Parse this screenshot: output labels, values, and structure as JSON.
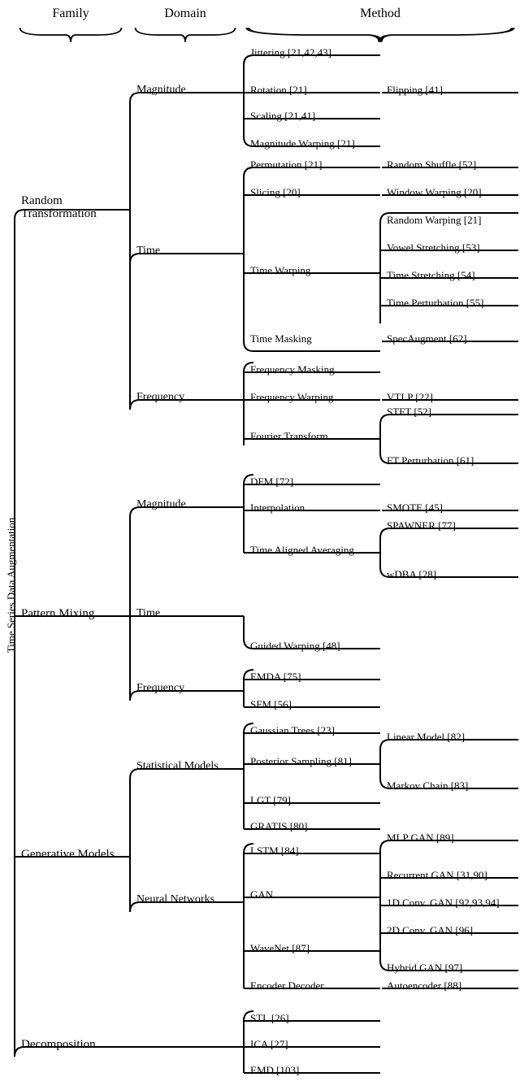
{
  "headers": {
    "family": "Family",
    "domain": "Domain",
    "method": "Method"
  },
  "root": "Time Series Data Augmentation",
  "fam_rt": "Random\nTransformation",
  "fam_pm": "Pattern Mixing",
  "fam_gm": "Generative Models",
  "fam_dc": "Decomposition",
  "d_mag": "Magnitude",
  "d_time": "Time",
  "d_freq": "Frequency",
  "d_stat": "Statistical Models",
  "d_nn": "Neural Networks",
  "m_jitter": "Jittering [21,42,43]",
  "m_rot": "Rotation [21]",
  "m_flip": "Flipping [41]",
  "m_scal": "Scaling [21,41]",
  "m_magw": "Magnitude Warping [21]",
  "m_perm": "Permutation [21]",
  "m_rshuf": "Random Shuffle [52]",
  "m_slic": "Slicing [20]",
  "m_wwarp": "Window Warping [20]",
  "m_twarp": "Time Warping",
  "m_rwarp": "Random Warping [21]",
  "m_vstr": "Vowel Stretching [53]",
  "m_tstr": "Time Stretching [54]",
  "m_tpert": "Time Perturbation [55]",
  "m_tmask": "Time Masking",
  "m_spec": "SpecAugment [62]",
  "m_fmask": "Frequency Masking",
  "m_fwarp": "Frequency Warping",
  "m_vtlp": "VTLP [22]",
  "m_four": "Fourier Transform",
  "m_stft": "STFT [52]",
  "m_ftp": "FT Perturbation [61]",
  "m_dfm": "DFM [72]",
  "m_interp": "Interpolation",
  "m_smote": "SMOTE [45]",
  "m_taa": "Time Aligned Averaging",
  "m_spawn": "SPAWNER [77]",
  "m_wdba": "wDBA [28]",
  "m_gwarp": "Guided Warping [48]",
  "m_emda": "EMDA [75]",
  "m_sfm": "SFM [56]",
  "m_gtree": "Gaussian Trees [23]",
  "m_psamp": "Posterior Sampling [81]",
  "m_linm": "Linear Model [82]",
  "m_mchain": "Markov Chain [83]",
  "m_lgt": "LGT [79]",
  "m_gratis": "GRATIS [80]",
  "m_lstm": "LSTM [84]",
  "m_gan": "GAN",
  "m_mlpgan": "MLP GAN [89]",
  "m_rgan": "Recurrent GAN [31,90]",
  "m_1dgan": "1D Conv. GAN [92,93,94]",
  "m_2dgan": "2D Conv. GAN [96]",
  "m_hgan": "Hybrid GAN [97]",
  "m_wave": "WaveNet [87]",
  "m_encdec": "Encoder Decoder",
  "m_auto": "Autoencoder [88]",
  "m_stl": "STL [26]",
  "m_ica": "ICA [27]",
  "m_emd": "EMD [103]"
}
